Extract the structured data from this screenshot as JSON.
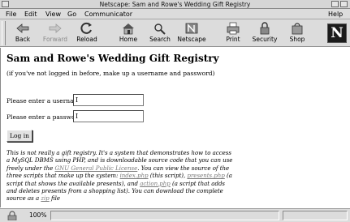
{
  "window": {
    "title": "Netscape: Sam and Rowe's Wedding Gift Registry"
  },
  "menu": {
    "file": "File",
    "edit": "Edit",
    "view": "View",
    "go": "Go",
    "communicator": "Communicator",
    "help": "Help"
  },
  "toolbar": {
    "back": "Back",
    "forward": "Forward",
    "reload": "Reload",
    "home": "Home",
    "search": "Search",
    "netscape": "Netscape",
    "print": "Print",
    "security": "Security",
    "shop": "Shop",
    "logo": "N"
  },
  "page": {
    "title": "Sam and Rowe's Wedding Gift Registry",
    "note": "(if you've not logged in before, make up a username and password)",
    "username_label": "Please enter a username:",
    "password_label": "Please enter a password:",
    "login_button": "Log in",
    "desc": {
      "t1": "This is not really a gift registry. It's a system that demonstrates how to access a MySQL DBMS using PHP, and is downloadable source code that you can use freely under the ",
      "gpl": "GNU General Public License",
      "t2": ". You can view the source of the three scripts that make up the system: ",
      "index": "index.php",
      "t3": " (this script), ",
      "presents": "presents.php",
      "t4": " (a script that shows the available presents), and ",
      "action": "action.php",
      "t5": " (a script that adds and deletes presents from a shopping list). You can download the complete source as a ",
      "zip": "zip",
      "t6": " file"
    }
  },
  "status": {
    "zoom": "100%"
  }
}
